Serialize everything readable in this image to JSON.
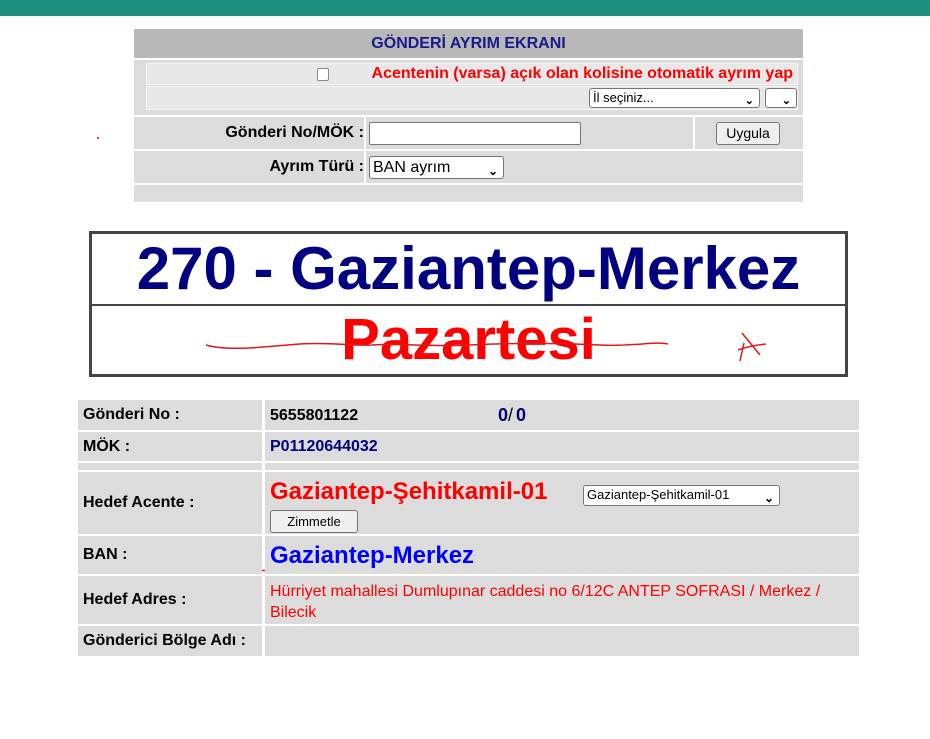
{
  "form": {
    "title": "GÖNDERİ AYRIM EKRANI",
    "auto_checkbox_label": "Acentenin (varsa) açık olan kolisine otomatik ayrım yap",
    "city_select": "İl seçiniz...",
    "shipment_label": "Gönderi No/MÖK :",
    "shipment_value": "",
    "apply_button": "Uygula",
    "sort_type_label": "Ayrım Türü :",
    "sort_type_value": "BAN ayrım"
  },
  "banner": {
    "code_city": "270 - Gaziantep-Merkez",
    "day": "Pazartesi"
  },
  "details": {
    "shipment_no_label": "Gönderi No :",
    "shipment_no_value": "5655801122",
    "count_left": "0",
    "count_sep": "/",
    "count_right": "0",
    "mok_label": "MÖK :",
    "mok_value": "P01120644032",
    "target_agency_label": "Hedef Acente :",
    "target_agency_value": "Gaziantep-Şehitkamil-01",
    "target_agency_select": "Gaziantep-Şehitkamil-01",
    "assign_button": "Zimmetle",
    "ban_label": "BAN :",
    "ban_value": "Gaziantep-Merkez",
    "address_label": "Hedef Adres :",
    "address_value": "Hürriyet mahallesi Dumlupınar caddesi no 6/12C ANTEP SOFRASI / Merkez / Bilecik",
    "sender_region_label": "Gönderici Bölge Adı :",
    "sender_region_value": ""
  },
  "colors": {
    "topbar": "#1f8f7f",
    "title_text": "#1a1a8c",
    "alert_red": "#ff0000",
    "navy": "#000080",
    "link_blue": "#0000ff",
    "cell_bg": "#dcdcdc"
  }
}
